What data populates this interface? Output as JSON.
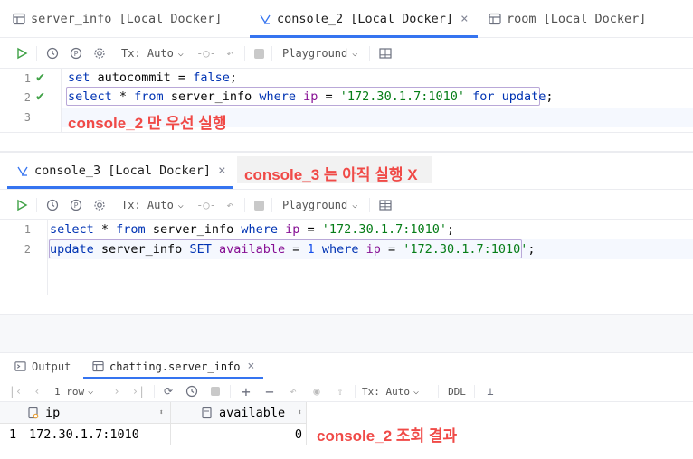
{
  "tabs": [
    {
      "label": "server_info [Local Docker]"
    },
    {
      "label": "console_2 [Local Docker]",
      "close": "×"
    },
    {
      "label": "room [Local Docker]"
    }
  ],
  "toolbar": {
    "tx": "Tx: Auto",
    "playground": "Playground"
  },
  "editor1": {
    "line_numbers": [
      "1",
      "2",
      "3"
    ],
    "line1": {
      "a": "set",
      "b": " autocommit = ",
      "c": "false",
      "d": ";"
    },
    "line2": {
      "a": "select",
      "b": " * ",
      "c": "from",
      "d": " server_info ",
      "e": "where",
      "f": " ",
      "g": "ip",
      "h": " = ",
      "i": "'172.30.1.7:1010'",
      "j": " ",
      "k": "for update",
      "l": ";"
    },
    "annotation": "console_2 만 우선 실행"
  },
  "console3_tab": {
    "label": "console_3 [Local Docker]",
    "close": "×",
    "annotation": "console_3 는 아직 실행 X"
  },
  "editor2": {
    "line_numbers": [
      "1",
      "2"
    ],
    "line1": {
      "a": "select",
      "b": " * ",
      "c": "from",
      "d": " server_info ",
      "e": "where",
      "f": " ",
      "g": "ip",
      "h": " = ",
      "i": "'172.30.1.7:1010'",
      "j": ";"
    },
    "line2": {
      "a": "update",
      "b": " server_info ",
      "c": "SET",
      "d": " ",
      "e": "available",
      "f": " = ",
      "g": "1",
      "h": " ",
      "i": "where",
      "j": " ",
      "k": "ip",
      "l": " = ",
      "m": "'172.30.1.7:1010'",
      "n": ";"
    }
  },
  "results": {
    "tabs": [
      {
        "label": "Output"
      },
      {
        "label": "chatting.server_info",
        "close": "×"
      }
    ],
    "rows_label": "1 row",
    "tx": "Tx: Auto",
    "ddl": "DDL",
    "columns": [
      {
        "label": "ip"
      },
      {
        "label": "available"
      }
    ],
    "rows": [
      {
        "num": "1",
        "ip": "172.30.1.7:1010",
        "available": "0"
      }
    ],
    "annotation": "console_2 조회 결과"
  },
  "colors": {
    "accent": "#3574f0",
    "annotation": "#f04a47",
    "keyword": "#0033b3",
    "string": "#067d17"
  }
}
